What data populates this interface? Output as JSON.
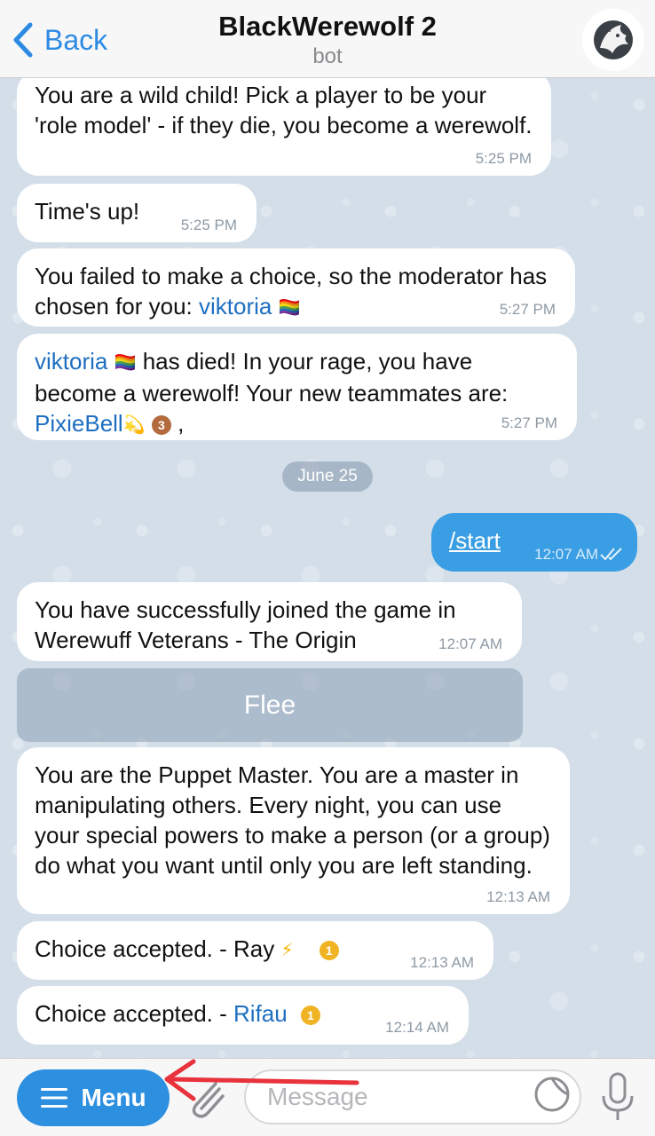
{
  "header": {
    "back_label": "Back",
    "title": "BlackWerewolf 2",
    "subtitle": "bot",
    "icons": {
      "back": "chevron-left-icon",
      "avatar": "wolf-avatar"
    }
  },
  "messages": [
    {
      "id": "m1",
      "text": "You are a wild child! Pick a player to be your 'role model' - if they die, you become a werewolf.",
      "time": "5:25 PM"
    },
    {
      "id": "m2",
      "text": "Time's up!",
      "time": "5:25 PM"
    },
    {
      "id": "m3",
      "text_before": "You failed to make a choice, so the moderator has chosen for you: ",
      "link": "viktoria",
      "emoji": "🏳️‍🌈",
      "time": "5:27 PM"
    },
    {
      "id": "m4",
      "link": "viktoria",
      "emoji": "🏳️‍🌈",
      "text_mid": " has died! In your rage, you have become a werewolf! Your new teammates are: ",
      "link2": "PixieBell",
      "emoji2": "💫",
      "medal": "3",
      "text_after": " ,",
      "time": "5:27 PM"
    },
    {
      "id": "date",
      "label": "June 25"
    },
    {
      "id": "m5",
      "text": "/start",
      "time": "12:07 AM",
      "outgoing": true
    },
    {
      "id": "m6",
      "text": "You have successfully joined the game in Werewuff Veterans - The Origin",
      "time": "12:07 AM"
    },
    {
      "id": "button",
      "label": "Flee"
    },
    {
      "id": "m7",
      "text": "You are the Puppet Master. You are a master in manipulating others. Every night, you can use your special powers to make a person (or a group) do what you want until only you are left standing.",
      "time": "12:13 AM"
    },
    {
      "id": "m8",
      "text_before": "Choice accepted. - Ray ",
      "emoji": "⚡",
      "medal": "1",
      "time": "12:13 AM"
    },
    {
      "id": "m9",
      "text_before": "Choice accepted. - ",
      "link": "Rifau",
      "medal": "1",
      "time": "12:14 AM"
    }
  ],
  "bottom_bar": {
    "menu_label": "Menu",
    "message_placeholder": "Message",
    "icons": {
      "menu": "hamburger-icon",
      "attach": "paperclip-icon",
      "sticker": "sticker-icon",
      "mic": "microphone-icon",
      "annotation": "red-arrow-icon"
    }
  },
  "colors": {
    "accent": "#2d8fe0",
    "link": "#1e6fc0",
    "annotation_arrow": "#e8323c"
  }
}
